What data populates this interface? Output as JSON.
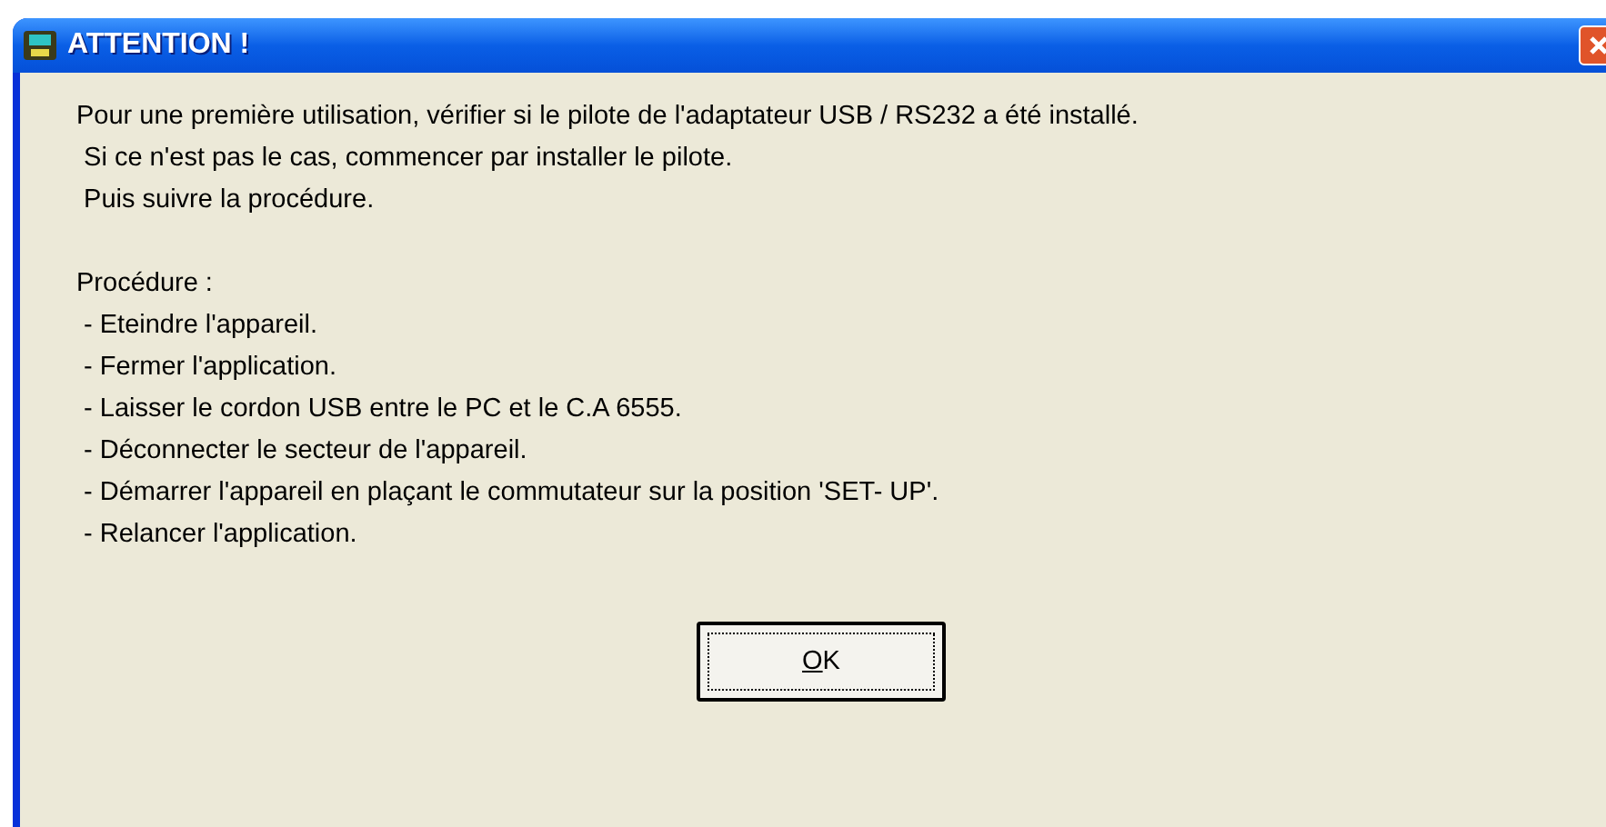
{
  "window": {
    "title": "ATTENTION !"
  },
  "message": {
    "intro": [
      "Pour une première utilisation, vérifier si le pilote de l'adaptateur USB / RS232 a été installé.",
      " Si ce n'est pas le cas, commencer par installer le pilote.",
      " Puis suivre la procédure."
    ],
    "procedure_heading": "Procédure :",
    "steps": [
      " - Eteindre l'appareil.",
      " - Fermer l'application.",
      " - Laisser le cordon USB entre le PC et le C.A 6555.",
      " - Déconnecter le secteur de l'appareil.",
      " - Démarrer l'appareil en plaçant le commutateur sur la position 'SET- UP'.",
      " - Relancer l'application."
    ]
  },
  "buttons": [
    {
      "label": "OK",
      "focused": true
    }
  ]
}
